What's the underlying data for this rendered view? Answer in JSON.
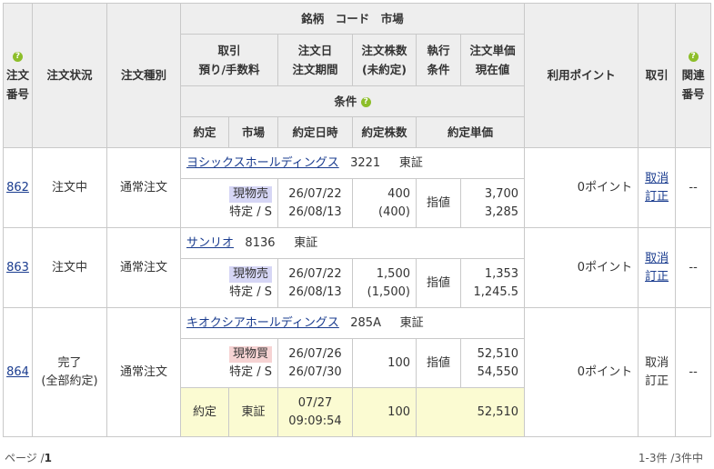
{
  "headers": {
    "order_no_1": "注文",
    "order_no_2": "番号",
    "status": "注文状況",
    "type": "注文種別",
    "stock": "銘柄　コード　市場",
    "trade_1": "取引",
    "trade_2": "預り/手数料",
    "order_date_1": "注文日",
    "order_date_2": "注文期間",
    "qty_1": "注文株数",
    "qty_2": "(未約定)",
    "cond_1": "執行",
    "cond_2": "条件",
    "price_1": "注文単価",
    "price_2": "現在値",
    "conditions": "条件",
    "points": "利用ポイント",
    "action": "取引",
    "related_1": "関連",
    "related_2": "番号",
    "exec": "約定",
    "market": "市場",
    "exec_datetime": "約定日時",
    "exec_qty": "約定株数",
    "exec_price": "約定単価"
  },
  "orders": [
    {
      "no": "862",
      "status": "注文中",
      "type": "通常注文",
      "stock_name": "ヨシックスホールディングス",
      "code": "3221",
      "market": "東証",
      "side": "現物売",
      "account": "特定 / S",
      "order_date": "26/07/22",
      "period": "26/08/13",
      "qty": "400",
      "unfilled": "(400)",
      "condition": "指値",
      "price": "3,700",
      "current": "3,285",
      "points": "0ポイント",
      "action_1": "取消",
      "action_2": "訂正",
      "related": "--"
    },
    {
      "no": "863",
      "status": "注文中",
      "type": "通常注文",
      "stock_name": "サンリオ",
      "code": "8136",
      "market": "東証",
      "side": "現物売",
      "account": "特定 / S",
      "order_date": "26/07/22",
      "period": "26/08/13",
      "qty": "1,500",
      "unfilled": "(1,500)",
      "condition": "指値",
      "price": "1,353",
      "current": "1,245.5",
      "points": "0ポイント",
      "action_1": "取消",
      "action_2": "訂正",
      "related": "--"
    },
    {
      "no": "864",
      "status_1": "完了",
      "status_2": "(全部約定)",
      "type": "通常注文",
      "stock_name": "キオクシアホールディングス",
      "code": "285A",
      "market": "東証",
      "side": "現物買",
      "account": "特定 / S",
      "order_date": "26/07/26",
      "period": "26/07/30",
      "qty": "100",
      "condition": "指値",
      "price": "52,510",
      "current": "54,550",
      "points": "0ポイント",
      "action_1": "取消",
      "action_2": "訂正",
      "related": "--",
      "exec_label": "約定",
      "exec_market": "東証",
      "exec_date": "07/27",
      "exec_time": "09:09:54",
      "exec_qty": "100",
      "exec_price": "52,510"
    }
  ],
  "footer": {
    "page_label": "ページ /",
    "page_num": "1",
    "count": "1-3件 /3件中"
  },
  "colors": {
    "header_bg": "#eeeeee",
    "sell_bg": "#d6d6f5",
    "buy_bg": "#f6d3d3",
    "exec_bg": "#fbfbd2",
    "link": "#1a3c8f",
    "help_icon": "#8dbe2a"
  }
}
